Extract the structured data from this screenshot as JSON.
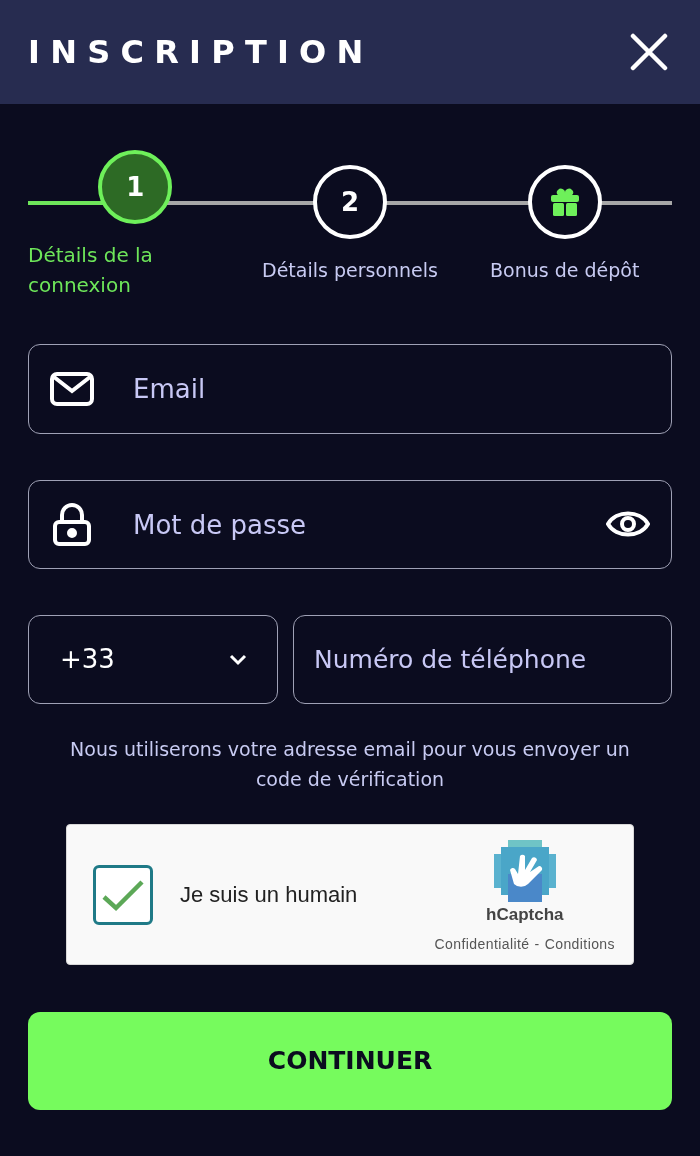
{
  "header": {
    "title": "INSCRIPTION"
  },
  "steps": [
    {
      "kind": "number",
      "number": "1",
      "label": "Détails de la connexion",
      "selected": true
    },
    {
      "kind": "number",
      "number": "2",
      "label": "Détails personnels",
      "selected": false
    },
    {
      "kind": "gift",
      "label": "Bonus de dépôt",
      "selected": false
    }
  ],
  "email": {
    "placeholder": "Email"
  },
  "password": {
    "placeholder": "Mot de passe"
  },
  "phone": {
    "country_code": "+33",
    "placeholder": "Numéro de téléphone"
  },
  "hint": "Nous utiliserons votre adresse email pour vous envoyer un code de vérification",
  "captcha": {
    "label": "Je suis un humain",
    "checked": true,
    "brand": "hCaptcha",
    "links": [
      "Confidentialité",
      "Conditions"
    ],
    "separator": "-"
  },
  "submit": "CONTINUER"
}
